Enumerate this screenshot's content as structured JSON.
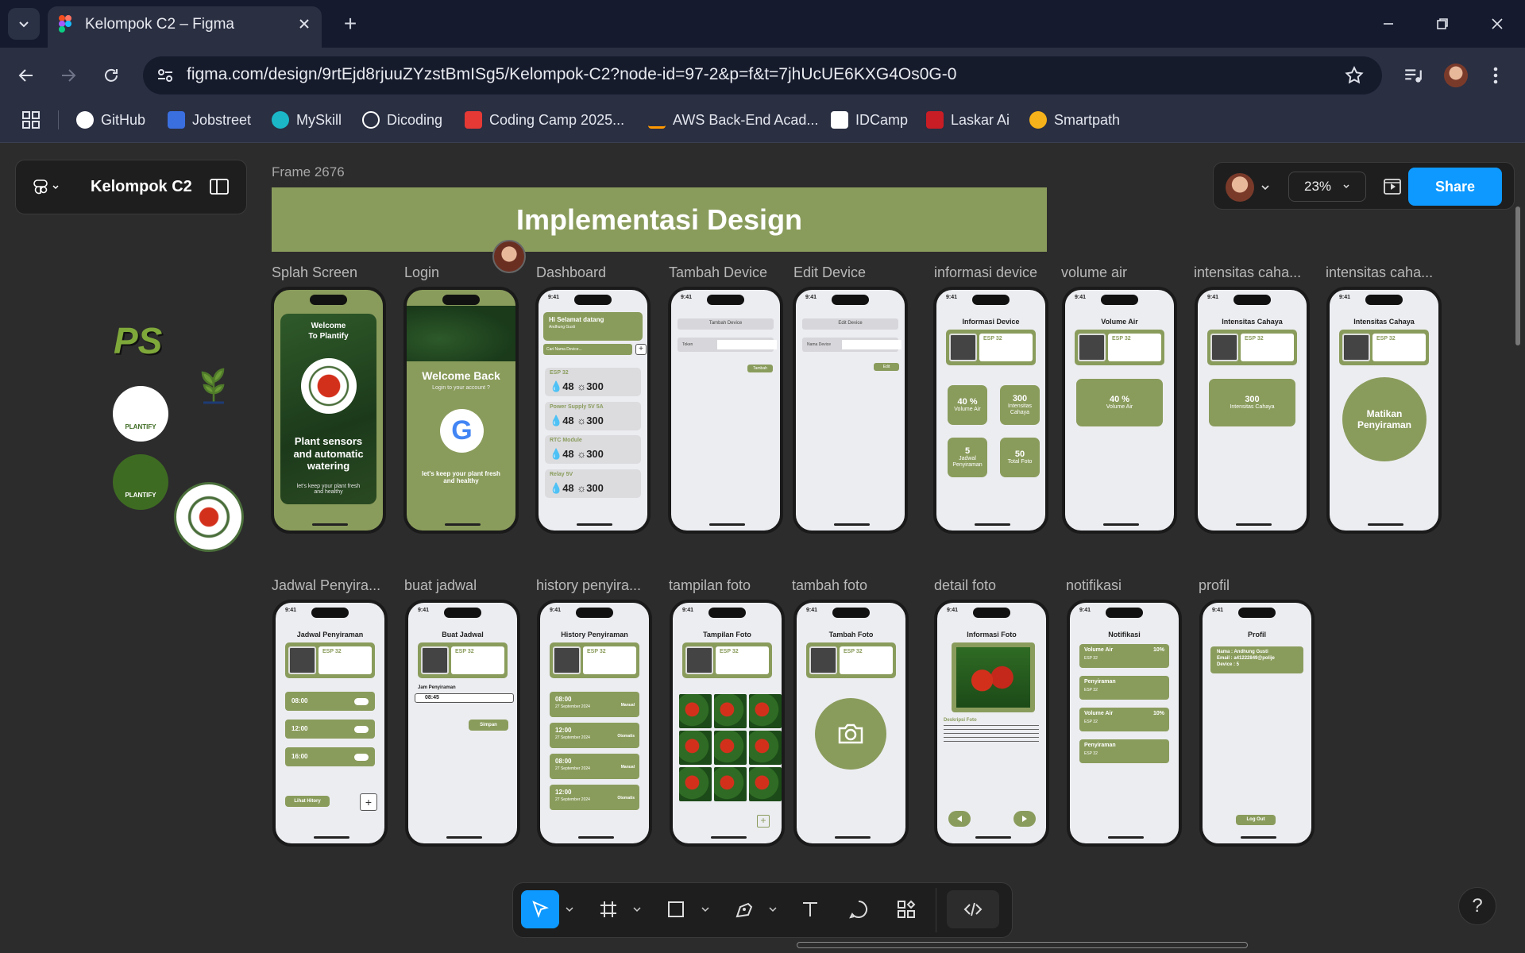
{
  "browser": {
    "tab_title": "Kelompok C2 – Figma",
    "url": "figma.com/design/9rtEjd8rjuuZYzstBmISg5/Kelompok-C2?node-id=97-2&p=f&t=7jhUcUE6KXG4Os0G-0",
    "bookmarks": [
      "GitHub",
      "Jobstreet",
      "MySkill",
      "Dicoding",
      "Coding Camp 2025...",
      "AWS Back-End Acad...",
      "IDCamp",
      "Laskar Ai",
      "Smartpath"
    ]
  },
  "figma": {
    "project": "Kelompok C2",
    "zoom": "23%",
    "share": "Share",
    "frame_label": "Frame 2676",
    "banner": "Implementasi Design",
    "help": "?"
  },
  "screens_row1": [
    "Splah Screen",
    "Login",
    "Dashboard",
    "Tambah Device",
    "Edit Device",
    "informasi device",
    "volume air",
    "intensitas caha...",
    "intensitas caha..."
  ],
  "screens_row2": [
    "Jadwal Penyira...",
    "buat jadwal",
    "history penyira...",
    "tampilan foto",
    "tambah foto",
    "detail foto",
    "notifikasi",
    "profil"
  ],
  "phone": {
    "time": "9:41",
    "splash_welcome": "Welcome To Plantify",
    "splash_tag": "Plant sensors and automatic watering",
    "splash_sub": "let's keep your plant fresh and healthy",
    "login_title": "Welcome Back",
    "login_sub": "Login to your account ?",
    "login_foot": "let's keep your plant fresh and healthy",
    "dash_greet": "Hi Selamat datang",
    "dash_user": "Andhung Gusti",
    "dash_search": "Cari Nama Device...",
    "devices": [
      {
        "name": "ESP 32",
        "water": "48",
        "light": "300"
      },
      {
        "name": "Power Supply 5V 5A",
        "water": "48",
        "light": "300"
      },
      {
        "name": "RTC Module",
        "water": "48",
        "light": "300"
      },
      {
        "name": "Relay 5V",
        "water": "48",
        "light": "300"
      }
    ],
    "tambah_title": "Tambah Device",
    "tambah_field": "Token",
    "tambah_btn": "Tambah",
    "edit_title": "Edit Device",
    "edit_field": "Nama Device",
    "edit_btn": "Edit",
    "info_title": "Informasi Device",
    "esp": "ESP 32",
    "vol_value": "40 %",
    "vol_label": "Volume Air",
    "light_value": "300",
    "light_label": "Intensitas Cahaya",
    "sched_value": "5",
    "sched_label": "Jadwal Penyiraman",
    "photo_value": "50",
    "photo_label": "Total Foto",
    "volume_title": "Volume Air",
    "intens_title": "Intensitas Cahaya",
    "matikan": "Matikan Penyiraman",
    "jadwal_title": "Jadwal Penyiraman",
    "jadwal_times": [
      "08:00",
      "12:00",
      "16:00"
    ],
    "lihat_history": "Lihat Hitory",
    "buat_title": "Buat Jadwal",
    "jam_label": "Jam Penyiraman",
    "jam_value": "08:45",
    "simpan": "Simpan",
    "history_title": "History Penyiraman",
    "history": [
      {
        "time": "08:00",
        "date": "27 September 2024",
        "mode": "Manual"
      },
      {
        "time": "12:00",
        "date": "27 September 2024",
        "mode": "Otomatis"
      },
      {
        "time": "08:00",
        "date": "27 September 2024",
        "mode": "Manual"
      },
      {
        "time": "12:00",
        "date": "27 September 2024",
        "mode": "Otomatis"
      }
    ],
    "foto_title": "Tampilan Foto",
    "tambahfoto_title": "Tambah Foto",
    "detail_title": "Informasi Foto",
    "deskripsi": "Deskripsi Foto",
    "notif_title": "Notifikasi",
    "notifs": [
      {
        "title": "Volume Air",
        "pct": "10%",
        "sub": "ESP 32"
      },
      {
        "title": "Penyiraman",
        "pct": "",
        "sub": "ESP 32"
      },
      {
        "title": "Volume Air",
        "pct": "10%",
        "sub": "ESP 32"
      },
      {
        "title": "Penyiraman",
        "pct": "",
        "sub": "ESP 32"
      }
    ],
    "profil_title": "Profil",
    "profil_name": "Nama : Andhung Gusti",
    "profil_email": "Email : a41222849@polije",
    "profil_device": "Device : 5",
    "logout": "Log Out"
  },
  "logos": {
    "plantify": "PLANTIFY",
    "ps": "PS"
  }
}
